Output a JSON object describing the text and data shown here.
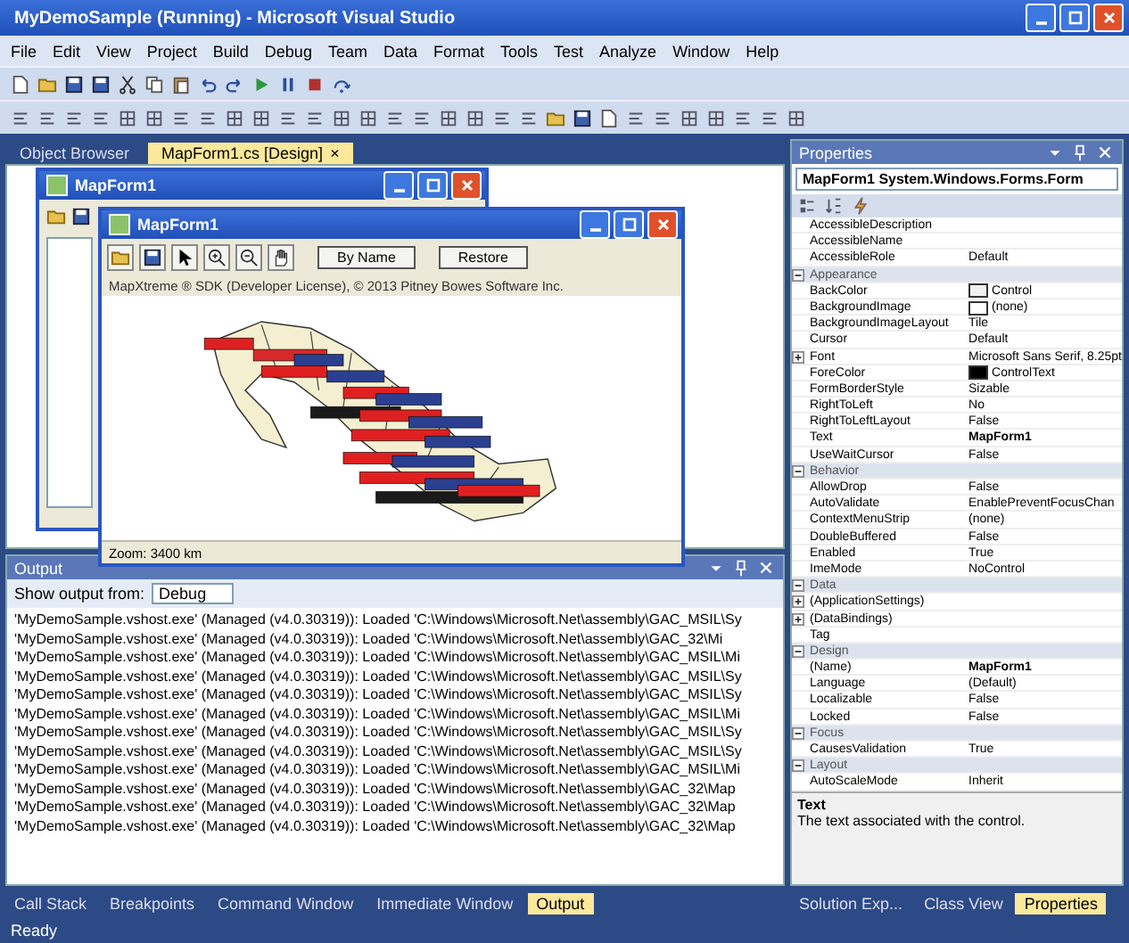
{
  "window": {
    "title": "MyDemoSample (Running) - Microsoft Visual Studio"
  },
  "menu": [
    "File",
    "Edit",
    "View",
    "Project",
    "Build",
    "Debug",
    "Team",
    "Data",
    "Format",
    "Tools",
    "Test",
    "Analyze",
    "Window",
    "Help"
  ],
  "document_tabs": [
    {
      "label": "Object Browser",
      "selected": false
    },
    {
      "label": "MapForm1.cs [Design]",
      "selected": true,
      "close": "×"
    }
  ],
  "designer_form": {
    "title": "MapForm1"
  },
  "running_form": {
    "title": "MapForm1",
    "buttons": [
      "By Name",
      "Restore"
    ],
    "copyright": "MapXtreme ® SDK (Developer License), © 2013 Pitney Bowes Software Inc.",
    "status": "Zoom: 3400 km"
  },
  "output": {
    "title": "Output",
    "show_from_label": "Show output from:",
    "show_from_value": "Debug",
    "lines": [
      "'MyDemoSample.vshost.exe' (Managed (v4.0.30319)): Loaded 'C:\\Windows\\Microsoft.Net\\assembly\\GAC_MSIL\\Sy",
      "'MyDemoSample.vshost.exe' (Managed (v4.0.30319)): Loaded 'C:\\Windows\\Microsoft.Net\\assembly\\GAC_32\\Mi",
      "'MyDemoSample.vshost.exe' (Managed (v4.0.30319)): Loaded 'C:\\Windows\\Microsoft.Net\\assembly\\GAC_MSIL\\Mi",
      "'MyDemoSample.vshost.exe' (Managed (v4.0.30319)): Loaded 'C:\\Windows\\Microsoft.Net\\assembly\\GAC_MSIL\\Sy",
      "'MyDemoSample.vshost.exe' (Managed (v4.0.30319)): Loaded 'C:\\Windows\\Microsoft.Net\\assembly\\GAC_MSIL\\Sy",
      "'MyDemoSample.vshost.exe' (Managed (v4.0.30319)): Loaded 'C:\\Windows\\Microsoft.Net\\assembly\\GAC_MSIL\\Mi",
      "'MyDemoSample.vshost.exe' (Managed (v4.0.30319)): Loaded 'C:\\Windows\\Microsoft.Net\\assembly\\GAC_MSIL\\Sy",
      "'MyDemoSample.vshost.exe' (Managed (v4.0.30319)): Loaded 'C:\\Windows\\Microsoft.Net\\assembly\\GAC_MSIL\\Sy",
      "'MyDemoSample.vshost.exe' (Managed (v4.0.30319)): Loaded 'C:\\Windows\\Microsoft.Net\\assembly\\GAC_MSIL\\Mi",
      "'MyDemoSample.vshost.exe' (Managed (v4.0.30319)): Loaded 'C:\\Windows\\Microsoft.Net\\assembly\\GAC_32\\Map",
      "'MyDemoSample.vshost.exe' (Managed (v4.0.30319)): Loaded 'C:\\Windows\\Microsoft.Net\\assembly\\GAC_32\\Map",
      "'MyDemoSample.vshost.exe' (Managed (v4.0.30319)): Loaded 'C:\\Windows\\Microsoft.Net\\assembly\\GAC_32\\Map"
    ]
  },
  "bottom_tabs": [
    {
      "label": "Call Stack",
      "selected": false
    },
    {
      "label": "Breakpoints",
      "selected": false
    },
    {
      "label": "Command Window",
      "selected": false
    },
    {
      "label": "Immediate Window",
      "selected": false
    },
    {
      "label": "Output",
      "selected": true
    }
  ],
  "properties": {
    "title": "Properties",
    "object": "MapForm1 System.Windows.Forms.Form",
    "rows": [
      {
        "kind": "property",
        "name": "AccessibleDescription"
      },
      {
        "kind": "property",
        "name": "AccessibleName"
      },
      {
        "kind": "property",
        "name": "AccessibleRole",
        "value": "Default"
      },
      {
        "kind": "category",
        "name": "Appearance",
        "expanded": true
      },
      {
        "kind": "property",
        "name": "BackColor",
        "value": "Control",
        "color": "#f0f0f0"
      },
      {
        "kind": "property",
        "name": "BackgroundImage",
        "value": "(none)",
        "color": "#ffffff"
      },
      {
        "kind": "property",
        "name": "BackgroundImageLayout",
        "value": "Tile"
      },
      {
        "kind": "property",
        "name": "Cursor",
        "value": "Default"
      },
      {
        "kind": "property",
        "name": "Font",
        "value": "Microsoft Sans Serif, 8.25pt",
        "expandable": true
      },
      {
        "kind": "property",
        "name": "ForeColor",
        "value": "ControlText",
        "color": "#000000"
      },
      {
        "kind": "property",
        "name": "FormBorderStyle",
        "value": "Sizable"
      },
      {
        "kind": "property",
        "name": "RightToLeft",
        "value": "No"
      },
      {
        "kind": "property",
        "name": "RightToLeftLayout",
        "value": "False"
      },
      {
        "kind": "property",
        "name": "Text",
        "value": "MapForm1",
        "modified": true
      },
      {
        "kind": "property",
        "name": "UseWaitCursor",
        "value": "False"
      },
      {
        "kind": "category",
        "name": "Behavior",
        "expanded": true
      },
      {
        "kind": "property",
        "name": "AllowDrop",
        "value": "False"
      },
      {
        "kind": "property",
        "name": "AutoValidate",
        "value": "EnablePreventFocusChan"
      },
      {
        "kind": "property",
        "name": "ContextMenuStrip",
        "value": "(none)"
      },
      {
        "kind": "property",
        "name": "DoubleBuffered",
        "value": "False"
      },
      {
        "kind": "property",
        "name": "Enabled",
        "value": "True"
      },
      {
        "kind": "property",
        "name": "ImeMode",
        "value": "NoControl"
      },
      {
        "kind": "category",
        "name": "Data",
        "expanded": true
      },
      {
        "kind": "property",
        "name": "(ApplicationSettings)",
        "expandable": true
      },
      {
        "kind": "property",
        "name": "(DataBindings)",
        "expandable": true
      },
      {
        "kind": "property",
        "name": "Tag"
      },
      {
        "kind": "category",
        "name": "Design",
        "expanded": true
      },
      {
        "kind": "property",
        "name": "(Name)",
        "value": "MapForm1",
        "modified": true
      },
      {
        "kind": "property",
        "name": "Language",
        "value": "(Default)"
      },
      {
        "kind": "property",
        "name": "Localizable",
        "value": "False"
      },
      {
        "kind": "property",
        "name": "Locked",
        "value": "False"
      },
      {
        "kind": "category",
        "name": "Focus",
        "expanded": true
      },
      {
        "kind": "property",
        "name": "CausesValidation",
        "value": "True"
      },
      {
        "kind": "category",
        "name": "Layout",
        "expanded": true
      },
      {
        "kind": "property",
        "name": "AutoScaleMode",
        "value": "Inherit"
      }
    ],
    "description_title": "Text",
    "description": "The text associated with the control."
  },
  "right_tabs": [
    {
      "label": "Solution Exp...",
      "selected": false
    },
    {
      "label": "Class View",
      "selected": false
    },
    {
      "label": "Properties",
      "selected": true
    }
  ],
  "status_bar": "Ready"
}
